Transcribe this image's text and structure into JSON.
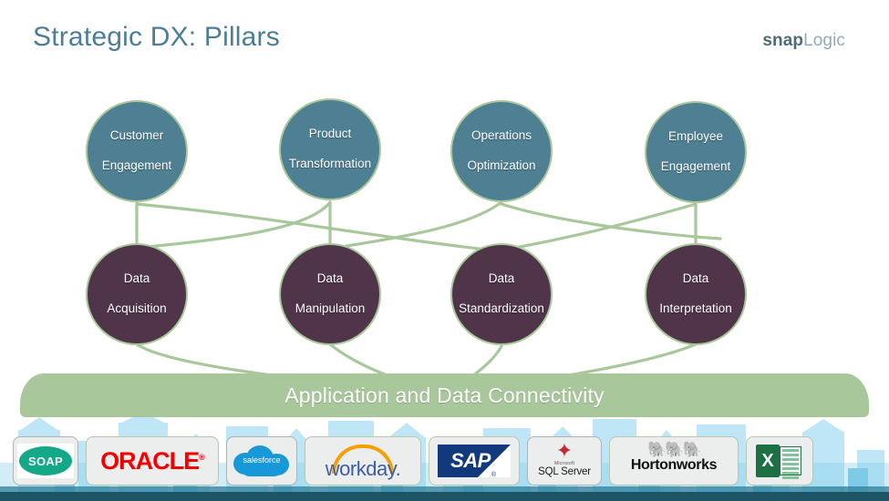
{
  "header": {
    "title": "Strategic DX: Pillars",
    "logo_part_a": "snap",
    "logo_part_b": "Logic"
  },
  "colors": {
    "title": "#4c7e95",
    "pillar_circle": "#4e7f92",
    "data_circle": "#50344a",
    "circle_border": "#a8c89b",
    "banner": "#a8c79b",
    "connector_line": "#a8c89b",
    "footer_bar": "#1d5566",
    "skyline": "#9fd8f0"
  },
  "pillars": [
    {
      "line1": "Customer",
      "line2": "Engagement"
    },
    {
      "line1": "Product",
      "line2": "Transformation"
    },
    {
      "line1": "Operations",
      "line2": "Optimization"
    },
    {
      "line1": "Employee",
      "line2": "Engagement"
    }
  ],
  "data_layers": [
    {
      "line1": "Data",
      "line2": "Acquisition"
    },
    {
      "line1": "Data",
      "line2": "Manipulation"
    },
    {
      "line1": "Data",
      "line2": "Standardization"
    },
    {
      "line1": "Data",
      "line2": "Interpretation"
    }
  ],
  "banner": {
    "label": "Application and Data Connectivity"
  },
  "logos": [
    {
      "name": "soap",
      "label": "SOAP"
    },
    {
      "name": "oracle",
      "label": "ORACLE"
    },
    {
      "name": "salesforce",
      "label": "salesforce"
    },
    {
      "name": "workday",
      "label": "workday."
    },
    {
      "name": "sap",
      "label": "SAP"
    },
    {
      "name": "sqlserver",
      "label": "SQL Server",
      "sublabel": "Microsoft"
    },
    {
      "name": "hortonworks",
      "label": "Hortonworks"
    },
    {
      "name": "excel",
      "label": "X"
    }
  ]
}
